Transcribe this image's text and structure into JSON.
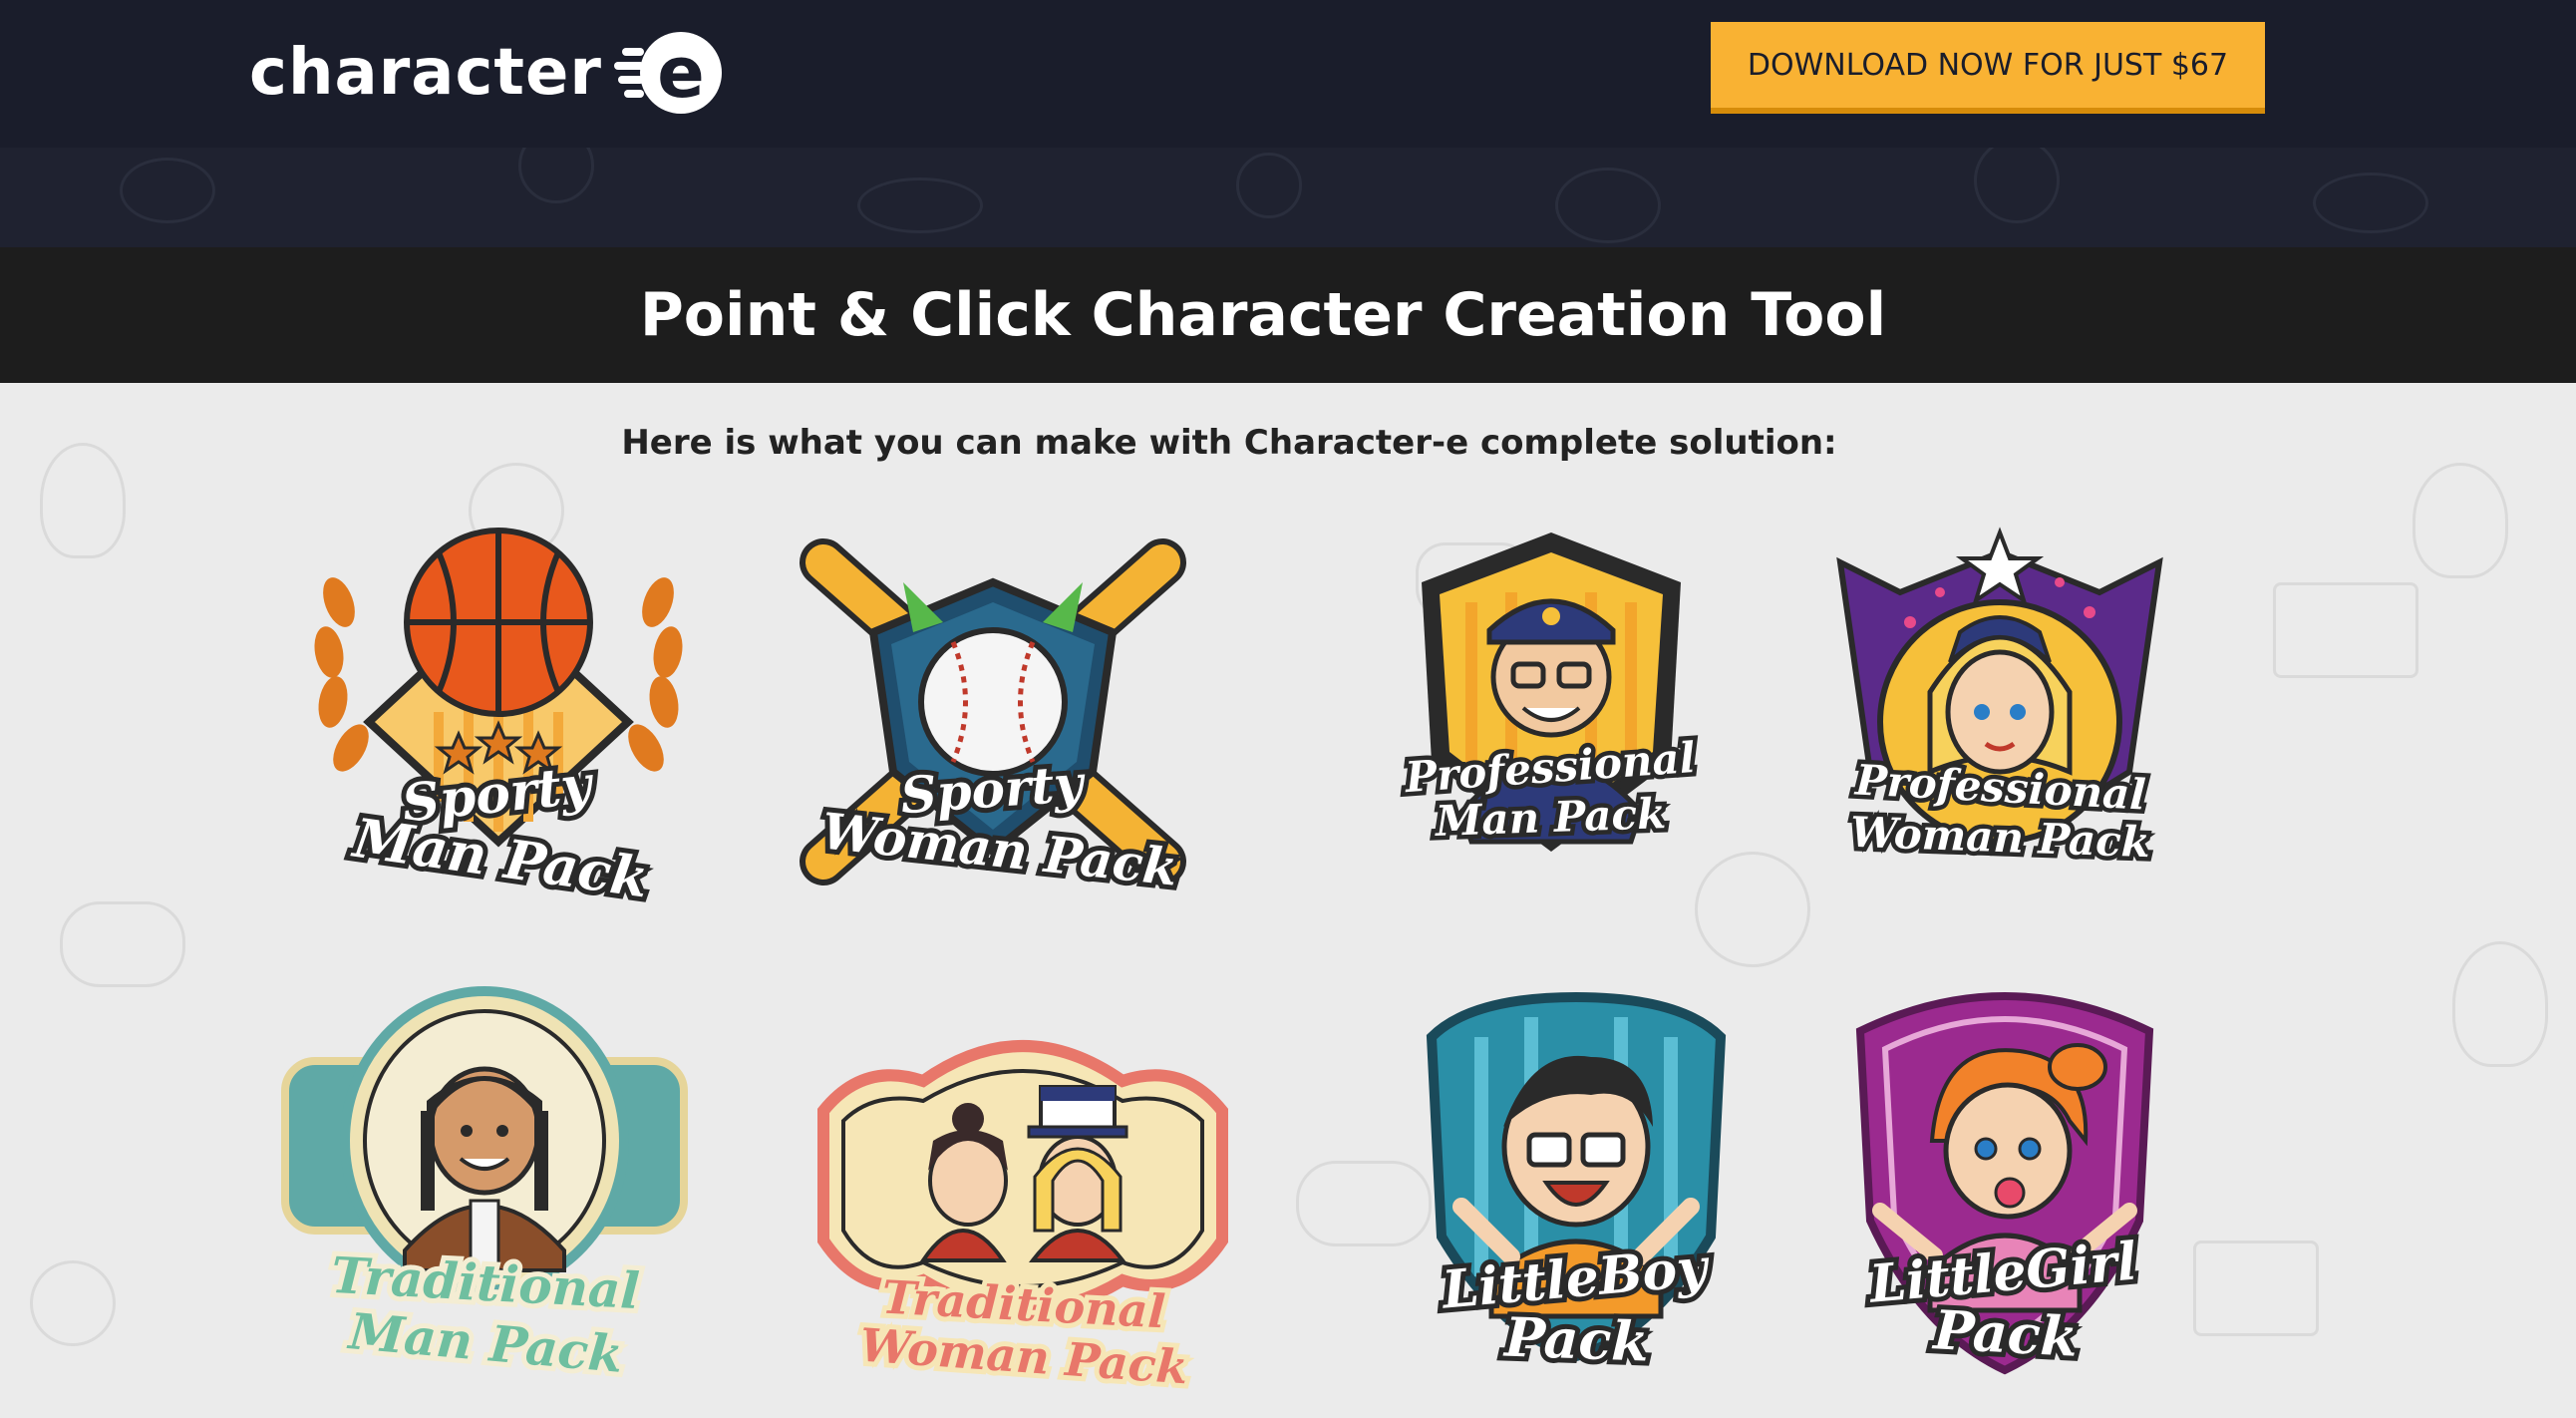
{
  "header": {
    "logo_text": "character",
    "logo_mark_letter": "e",
    "cta_label": "DOWNLOAD NOW FOR JUST $67"
  },
  "hero": {
    "title": "Point & Click Character Creation Tool"
  },
  "main": {
    "subtitle": "Here is what you can make with Character-e complete solution:"
  },
  "packs": [
    {
      "line1": "Sporty",
      "line2": "Man Pack",
      "icon": "basketball-icon"
    },
    {
      "line1": "Sporty",
      "line2": "Woman Pack",
      "icon": "baseball-icon"
    },
    {
      "line1": "Professional",
      "line2": "Man Pack",
      "icon": "police-officer-icon"
    },
    {
      "line1": "Professional",
      "line2": "Woman Pack",
      "icon": "flight-attendant-icon"
    },
    {
      "line1": "Traditional",
      "line2": "Man Pack",
      "icon": "native-man-icon"
    },
    {
      "line1": "Traditional",
      "line2": "Woman Pack",
      "icon": "two-women-icon"
    },
    {
      "line1": "LittleBoy",
      "line2": "Pack",
      "icon": "little-boy-icon"
    },
    {
      "line1": "LittleGirl",
      "line2": "Pack",
      "icon": "little-girl-icon"
    }
  ],
  "colors": {
    "header_bg": "#1a1d2b",
    "cta_bg": "#f9b233",
    "title_band_bg": "#1d1d1d",
    "page_bg": "#ebebeb"
  }
}
